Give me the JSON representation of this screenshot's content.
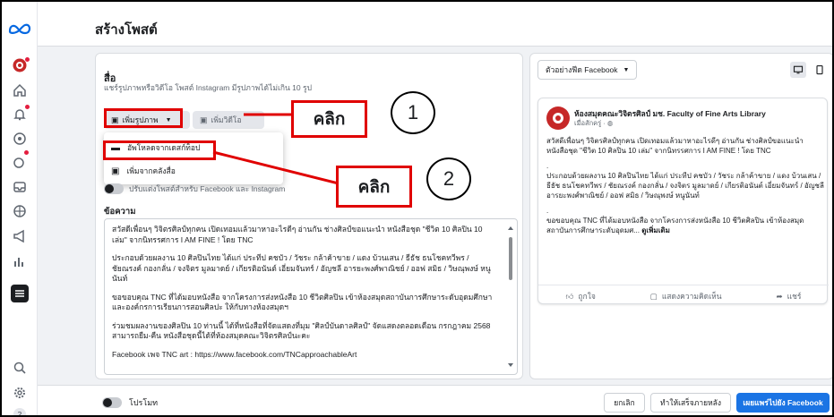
{
  "page": {
    "title": "สร้างโพสต์"
  },
  "rail": {
    "icons": [
      "meta-logo-icon",
      "profile-icon",
      "home-icon",
      "notification-icon",
      "compass-icon",
      "activity-icon",
      "inbox-icon",
      "grid-icon",
      "megaphone-icon",
      "insights-icon",
      "menu-icon",
      "search-icon",
      "settings-icon",
      "help-icon"
    ]
  },
  "media": {
    "title": "สื่อ",
    "description": "แชร์รูปภาพหรือวิดีโอ โพสต์ Instagram มีรูปภาพได้ไม่เกิน 10 รูป",
    "add_photo_label": "เพิ่มรูปภาพ",
    "add_video_label": "เพิ่มวิดีโอ",
    "menu": {
      "upload_desktop": "อัพโหลดจากเดสก์ท็อป",
      "add_from_library": "เพิ่มจากคลังสื่อ"
    }
  },
  "customize_toggle_label": "ปรับแต่งโพสต์สำหรับ Facebook และ Instagram",
  "text_section": {
    "label": "ข้อความ",
    "paragraphs": [
      "สวัสดีเพื่อนๆ วิจิตรศิลป์ทุกคน เปิดเทอมแล้วมาหาอะไรดีๆ อ่านกัน ช่างศิลป์ขอแนะนำ หนังสือชุด \"ชีวิต 10 ศิลปิน 10 เล่ม\" จากนิทรรศการ I AM FINE ! โดย TNC",
      "ประกอบด้วยผลงาน 10 ศิลปินไทย ได้แก่ ประทีป คชบัว / วัชระ กล้าค้าขาย / แดง บ้วนเสน / ธีธัช ธนโชคทวีพร / ชัยณรงค์ กองกลั่น / จงจิตร มูลมาดย์ / เกียรติอนันต์ เอี่ยมจันทร์ / อัญชลี อารยะพงศ์พาณิชย์ / ออฟ สมิธ / วิษณุพงษ์ หนูนันท์",
      "ขอขอบคุณ TNC ที่ได้มอบหนังสือ จากโครงการส่งหนังสือ 10 ชีวิตศิลปิน เข้าห้องสมุดสถาบันการศึกษาระดับอุดมศึกษา และองค์กรการเรียนการสอนศิลปะ ให้กับทางห้องสมุดฯ",
      "ร่วมชมผลงานของศิลปิน 10 ท่านนี้ ได้ที่หนังสือที่จัดแสดงที่มุม \"ศิลป์บันดาลศิลป์\" จัดแสดงตลอดเดือน กรกฎาคม 2568 สามารถยืม-คืน หนังสือชุดนี้ได้ที่ห้องสมุดคณะวิจิตรศิลป์นะคะ",
      "Facebook เพจ TNC art : https://www.facebook.com/TNCapproachableArt"
    ]
  },
  "preview": {
    "selector_label": "ตัวอย่างฟีด Facebook",
    "page_name": "ห้องสมุดคณะวิจิตรศิลป์ มช. Faculty of Fine Arts Library",
    "post_time": "เมื่อสักครู่ · ",
    "body": [
      "สวัสดีเพื่อนๆ วิจิตรศิลป์ทุกคน เปิดเทอมแล้วมาหาอะไรดีๆ อ่านกัน ช่างศิลป์ขอแนะนำ หนังสือชุด \"ชีวิต 10 ศิลปิน 10 เล่ม\" จากนิทรรศการ I AM FINE ! โดย TNC",
      ".",
      "ประกอบด้วยผลงาน 10 ศิลปินไทย ได้แก่ ประทีป คชบัว / วัชระ กล้าค้าขาย / แดง บ้วนเสน / ธีธัช ธนโชคทวีพร / ชัยณรงค์ กองกลั่น / จงจิตร มูลมาดย์ / เกียรติอนันต์ เอี่ยมจันทร์ / อัญชลี อารยะพงศ์พาณิชย์ / ออฟ สมิธ / วิษณุพงษ์ หนูนันท์",
      ".",
      "ขอขอบคุณ TNC ที่ได้มอบหนังสือ จากโครงการส่งหนังสือ 10 ชีวิตศิลปิน เข้าห้องสมุดสถาบันการศึกษาระดับอุดมศ..."
    ],
    "see_more": "ดูเพิ่มเติม",
    "like_label": "ถูกใจ",
    "comment_label": "แสดงความคิดเห็น",
    "share_label": "แชร์"
  },
  "bottom": {
    "promote_label": "โปรโมท",
    "cancel_label": "ยกเลิก",
    "finish_later_label": "ทำให้เสร็จภายหลัง",
    "publish_label": "เผยแพร่ไปยัง Facebook"
  },
  "annotations": {
    "step1_number": "1",
    "step1_label": "คลิก",
    "step2_number": "2",
    "step2_label": "คลิก",
    "color": "#e00000"
  },
  "colors": {
    "primary": "#1b74e4",
    "notification_dot": "#e41e3f"
  }
}
